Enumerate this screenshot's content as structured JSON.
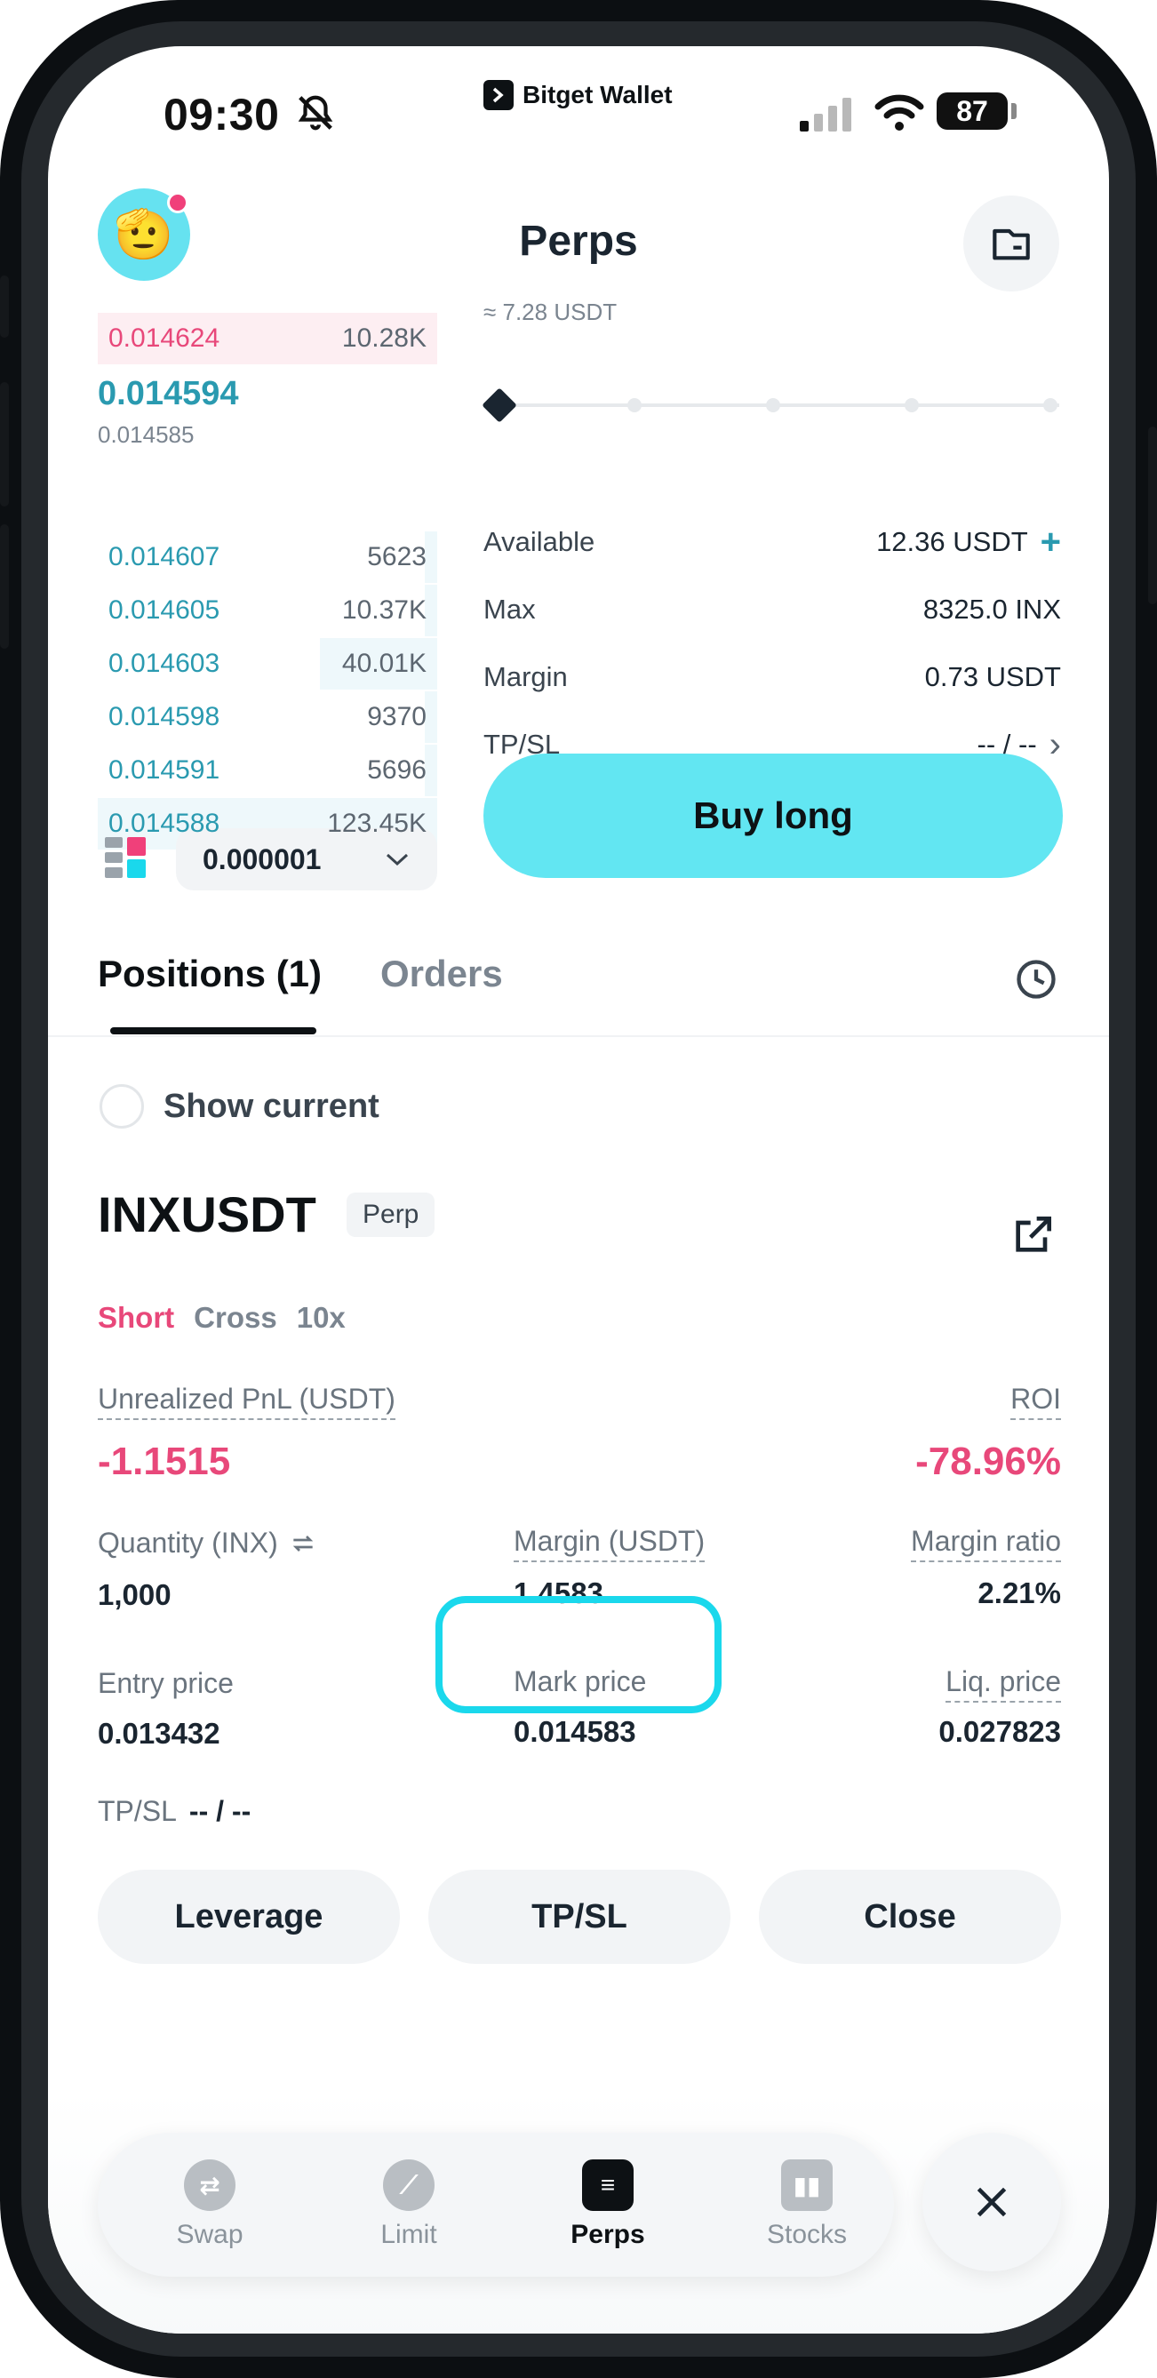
{
  "status_bar": {
    "time": "09:30",
    "brand": "Bitget Wallet",
    "battery": "87"
  },
  "header": {
    "title": "Perps"
  },
  "order_book": {
    "top_ask": {
      "price": "0.014624",
      "qty": "10.28K"
    },
    "mid_price": "0.014594",
    "mark_price": "0.014585",
    "bids": [
      {
        "price": "0.014607",
        "qty": "5623"
      },
      {
        "price": "0.014605",
        "qty": "10.37K"
      },
      {
        "price": "0.014603",
        "qty": "40.01K"
      },
      {
        "price": "0.014598",
        "qty": "9370"
      },
      {
        "price": "0.014591",
        "qty": "5696"
      },
      {
        "price": "0.014588",
        "qty": "123.45K"
      }
    ],
    "precision": "0.000001"
  },
  "order_form": {
    "approx": "≈ 7.28 USDT",
    "available_label": "Available",
    "available_value": "12.36 USDT",
    "max_label": "Max",
    "max_value": "8325.0 INX",
    "margin_label": "Margin",
    "margin_value": "0.73 USDT",
    "tpsl_label": "TP/SL",
    "tpsl_value": "-- / --",
    "buy_label": "Buy long"
  },
  "tabs": {
    "positions": "Positions (1)",
    "orders": "Orders"
  },
  "show_current": "Show current",
  "position": {
    "symbol": "INXUSDT",
    "badge": "Perp",
    "side": "Short",
    "mode": "Cross",
    "leverage": "10x",
    "upnl_label": "Unrealized PnL (USDT)",
    "upnl_value": "-1.1515",
    "roi_label": "ROI",
    "roi_value": "-78.96%",
    "quantity_label": "Quantity (INX)",
    "quantity_value": "1,000",
    "margin_label": "Margin (USDT)",
    "margin_value": "1.4583",
    "margin_ratio_label": "Margin ratio",
    "margin_ratio_value": "2.21%",
    "entry_label": "Entry price",
    "entry_value": "0.013432",
    "mark_label": "Mark price",
    "mark_value": "0.014583",
    "liq_label": "Liq. price",
    "liq_value": "0.027823",
    "tpsl_label": "TP/SL",
    "tpsl_value": "-- / --"
  },
  "actions": {
    "leverage": "Leverage",
    "tpsl": "TP/SL",
    "close": "Close"
  },
  "bottom_nav": {
    "swap": "Swap",
    "limit": "Limit",
    "perps": "Perps",
    "stocks": "Stocks"
  },
  "colors": {
    "accent": "#62e6f2",
    "red": "#e8487a",
    "teal": "#2a9ab0",
    "highlight": "#1ad8ec"
  }
}
